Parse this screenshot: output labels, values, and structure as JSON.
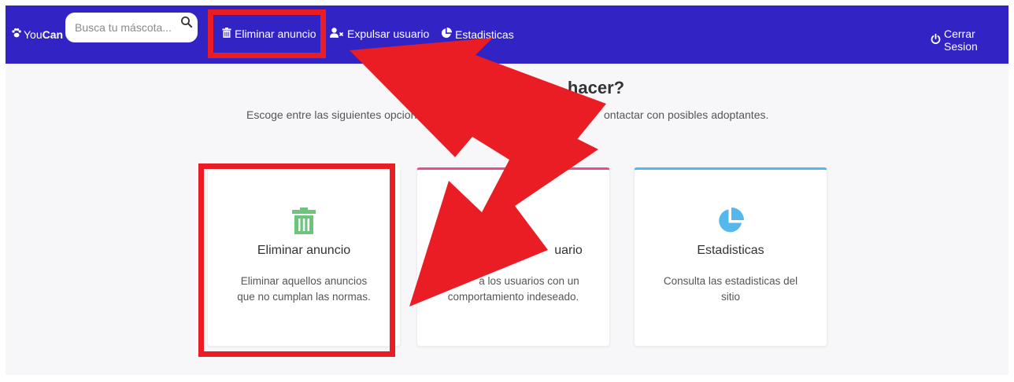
{
  "navbar": {
    "brand_prefix": "You",
    "brand_suffix": "Can",
    "search_placeholder": "Busca tu máscota...",
    "links": [
      {
        "label": "Eliminar anuncio",
        "icon": "trash-icon"
      },
      {
        "label": "Expulsar usuario",
        "icon": "user-remove-icon"
      },
      {
        "label": "Estadisticas",
        "icon": "pie-chart-icon"
      }
    ],
    "logout_label": "Cerrar Sesion",
    "bg_color": "#3223c4"
  },
  "hero": {
    "title": "hacer?",
    "subtitle_left": "Escoge entre las siguientes opcione",
    "subtitle_right": "ontactar con posibles adoptantes."
  },
  "cards": [
    {
      "title": "Eliminar anuncio",
      "desc_line1": "Eliminar aquellos anuncios",
      "desc_line2": "que no cumplan las normas.",
      "icon": "trash-icon",
      "color": "#6dc47b"
    },
    {
      "title": "uario",
      "desc_line1": "a los usuarios con un",
      "desc_line2": "comportamiento indeseado.",
      "icon": "user-remove-icon",
      "color": "#ec4b8a"
    },
    {
      "title": "Estadisticas",
      "desc_line1": "Consulta las estadisticas del",
      "desc_line2": "sitio",
      "icon": "pie-chart-icon",
      "color": "#54b8ec"
    }
  ],
  "annotation_color": "#ea1d25"
}
